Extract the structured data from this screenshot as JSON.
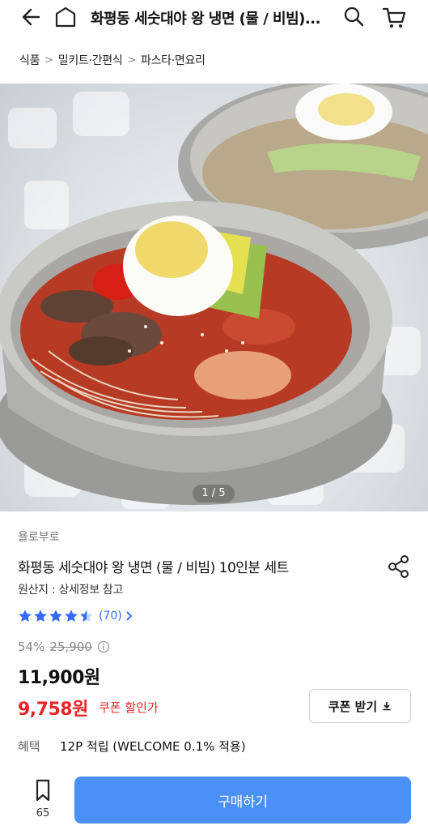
{
  "header": {
    "title": "화평동 세숫대야 왕 냉면 (물 / 비빔)..."
  },
  "breadcrumb": [
    "식품",
    "밀키트·간편식",
    "파스타·면요리"
  ],
  "gallery": {
    "counter": "1 / 5"
  },
  "product": {
    "brand": "욜로부로",
    "name": "화평동 세숫대야 왕 냉면 (물 / 비빔) 10인분 세트",
    "origin": "원산지 : 상세정보 참고",
    "rating": 4.5,
    "review_count": "(70)"
  },
  "price": {
    "discount": "54%",
    "original": "25,900",
    "sale": "11,900원",
    "coupon_price": "9,758원",
    "coupon_label": "쿠폰 할인가",
    "coupon_button": "쿠폰 받기"
  },
  "benefit": {
    "label": "혜택",
    "value": "12P 적립 (WELCOME 0.1% 적용)"
  },
  "bottom": {
    "wish_count": "65",
    "buy_label": "구매하기"
  },
  "colors": {
    "accent_blue": "#346aff",
    "buy_button": "#4a90f7",
    "coupon_red": "#e52528"
  }
}
